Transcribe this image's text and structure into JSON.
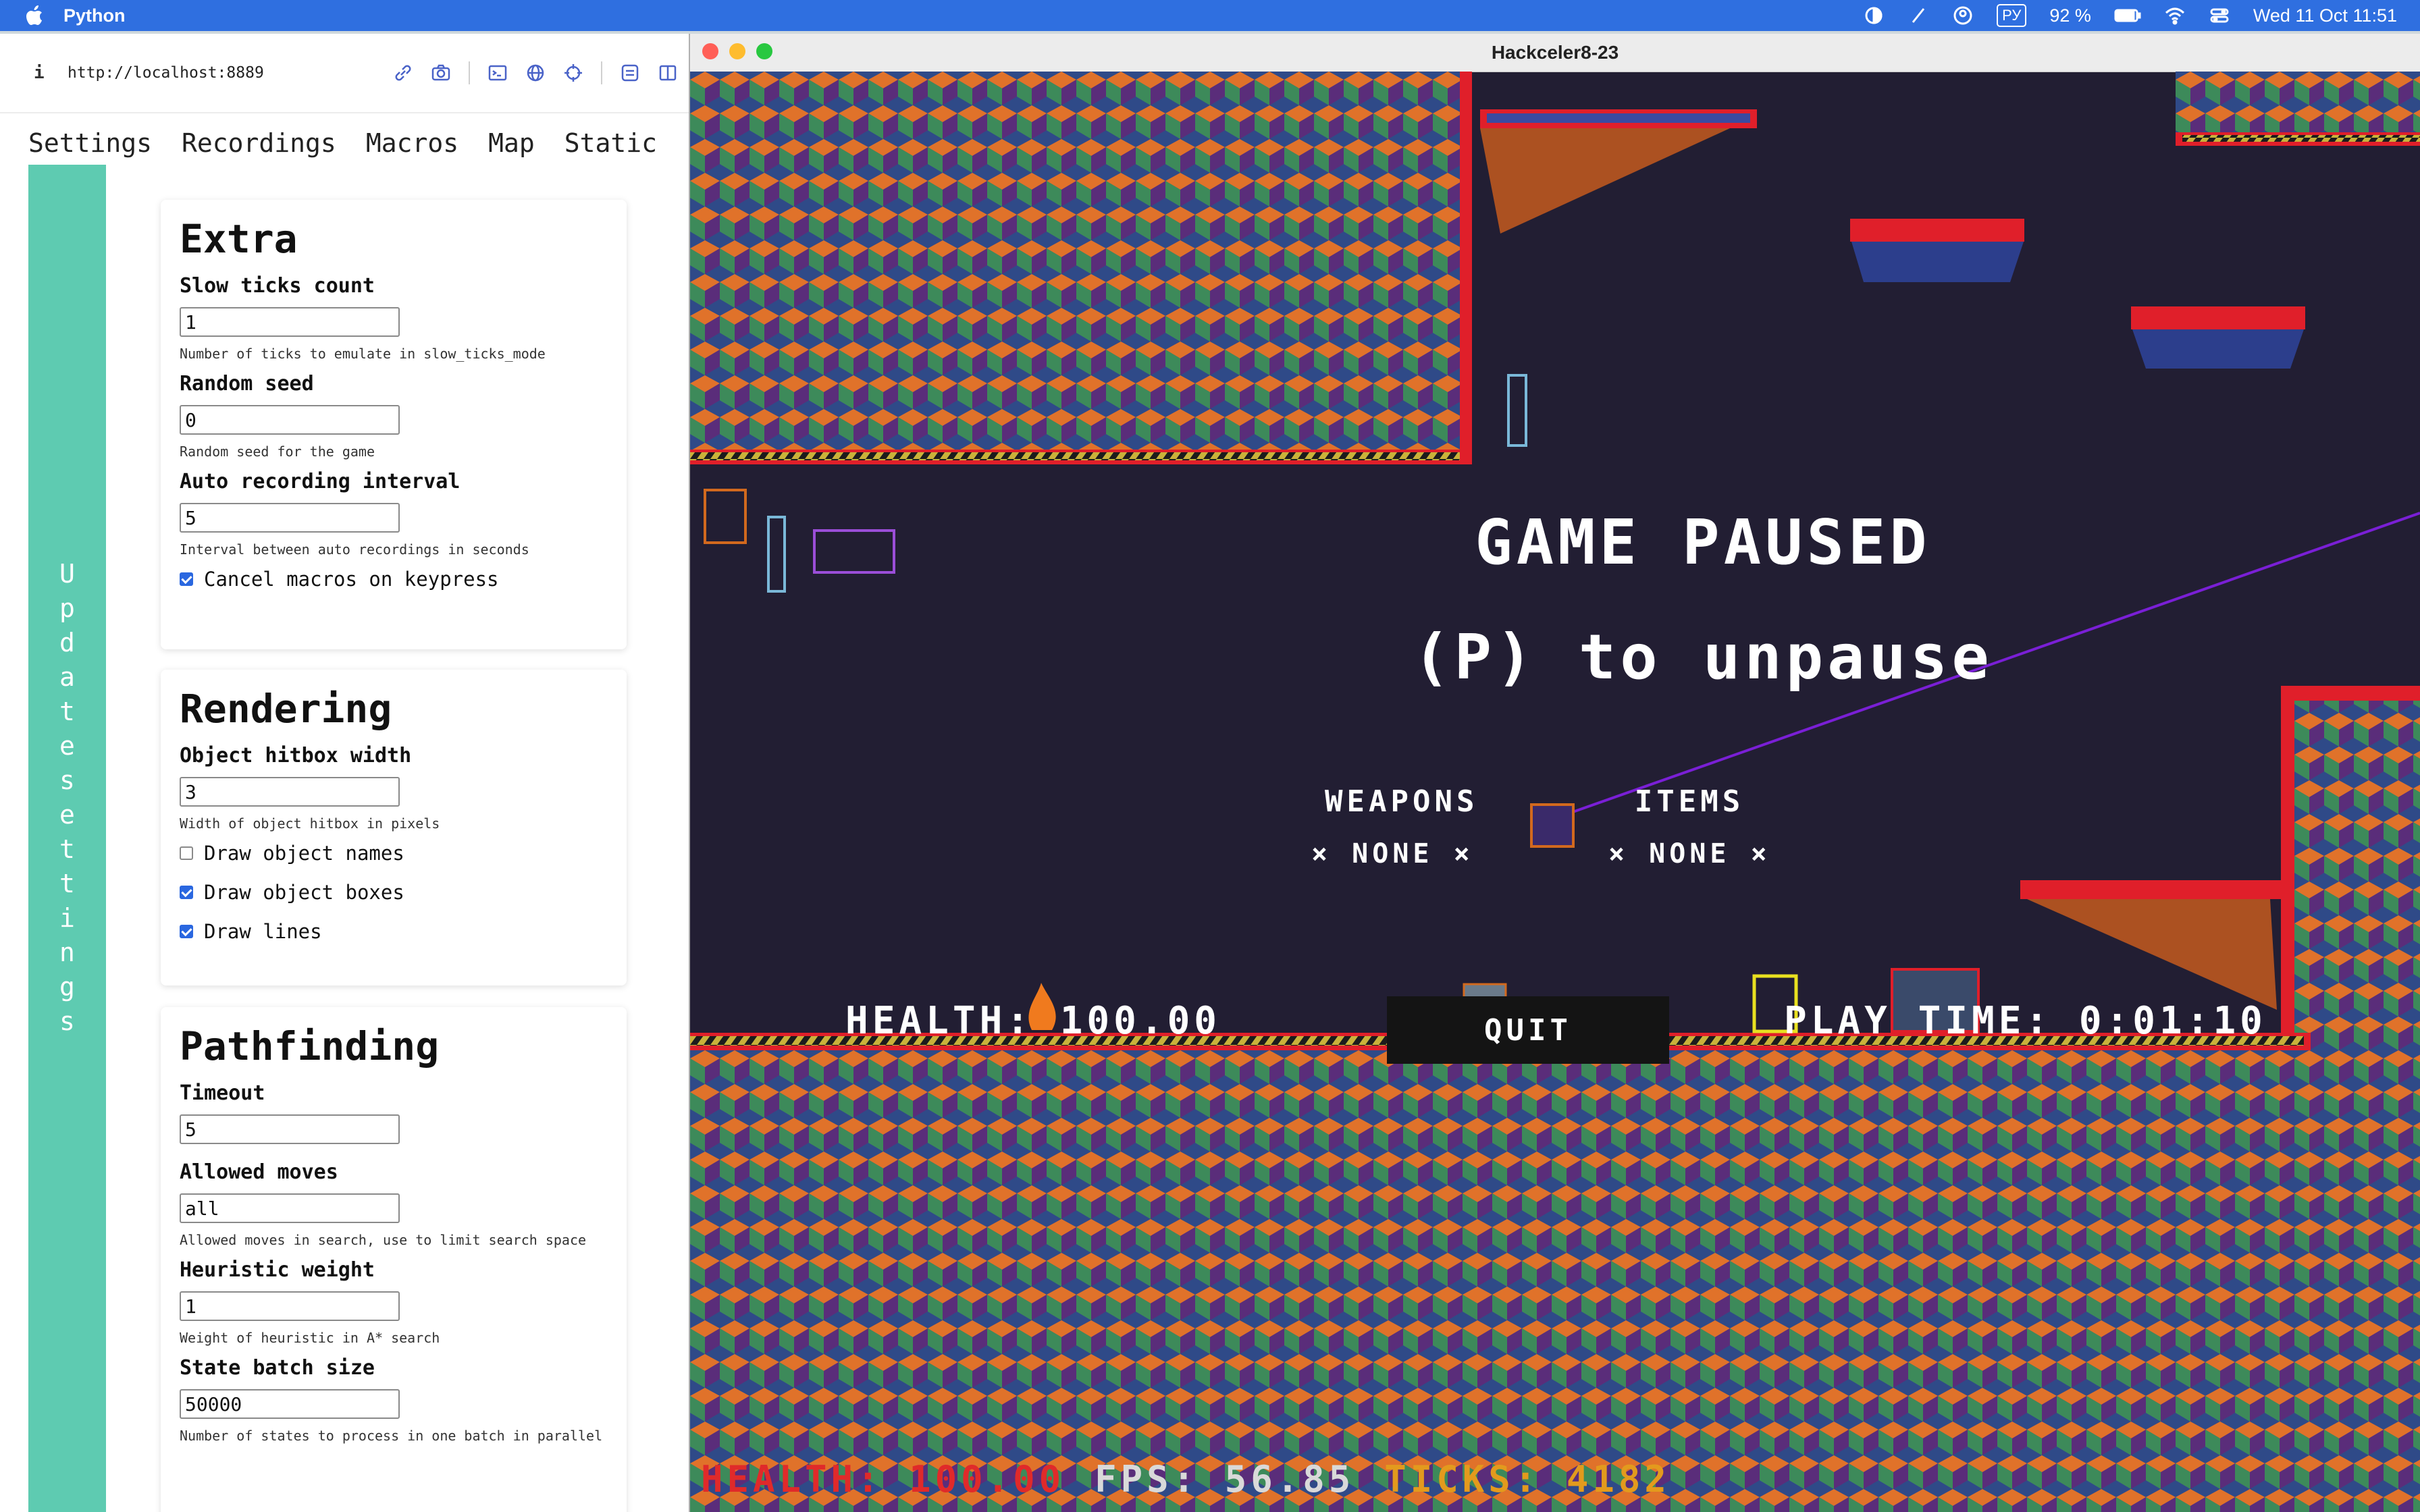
{
  "menubar": {
    "app_name": "Python",
    "battery": "92 %",
    "input_source": "РУ",
    "datetime": "Wed 11 Oct  11:51"
  },
  "browser": {
    "url": "http://localhost:8889",
    "info_icon": "i",
    "tabs": [
      "Settings",
      "Recordings",
      "Macros",
      "Map",
      "Static"
    ],
    "update_button": "Update settings"
  },
  "extra": {
    "title": "Extra",
    "slow_ticks_label": "Slow ticks count",
    "slow_ticks_value": "1",
    "slow_ticks_help": "Number of ticks to emulate in slow_ticks_mode",
    "seed_label": "Random seed",
    "seed_value": "0",
    "seed_help": "Random seed for the game",
    "auto_rec_label": "Auto recording interval",
    "auto_rec_value": "5",
    "auto_rec_help": "Interval between auto recordings in seconds",
    "cancel_macros_label": "Cancel macros on keypress",
    "cancel_macros_checked": true
  },
  "rendering": {
    "title": "Rendering",
    "hitbox_label": "Object hitbox width",
    "hitbox_value": "3",
    "hitbox_help": "Width of object hitbox in pixels",
    "draw_names_label": "Draw object names",
    "draw_names_checked": false,
    "draw_boxes_label": "Draw object boxes",
    "draw_boxes_checked": true,
    "draw_lines_label": "Draw lines",
    "draw_lines_checked": true
  },
  "pathfinding": {
    "title": "Pathfinding",
    "timeout_label": "Timeout",
    "timeout_value": "5",
    "moves_label": "Allowed moves",
    "moves_value": "all",
    "moves_help": "Allowed moves in search, use to limit search space",
    "heuristic_label": "Heuristic weight",
    "heuristic_value": "1",
    "heuristic_help": "Weight of heuristic in A* search",
    "batch_label": "State batch size",
    "batch_value": "50000",
    "batch_help": "Number of states to process in one batch in parallel"
  },
  "game": {
    "window_title": "Hackceler8-23",
    "paused_title": "GAME PAUSED",
    "paused_sub": "(P) to unpause",
    "weapons_label": "WEAPONS",
    "weapons_value": "× NONE ×",
    "items_label": "ITEMS",
    "items_value": "× NONE ×",
    "health_hud": "HEALTH: 100.00",
    "quit_label": "QUIT",
    "playtime_hud": "PLAY TIME: 0:01:10",
    "debug_health": "HEALTH: 100.00",
    "debug_fps": "FPS: 56.85",
    "debug_ticks": "TICKS: 4182"
  },
  "colors": {
    "menubar": "#2f6fe0",
    "update_button": "#5ecbb1",
    "game_bg": "#221e33",
    "platform_red": "#e01f2a",
    "path_line": "#7a1fd6"
  },
  "icons": [
    "apple-icon",
    "link-icon",
    "camera-icon",
    "terminal-icon",
    "globe-icon",
    "crosshair-icon",
    "layout-icon",
    "sidebar-icon",
    "wifi-icon",
    "battery-icon",
    "control-center-icon"
  ]
}
